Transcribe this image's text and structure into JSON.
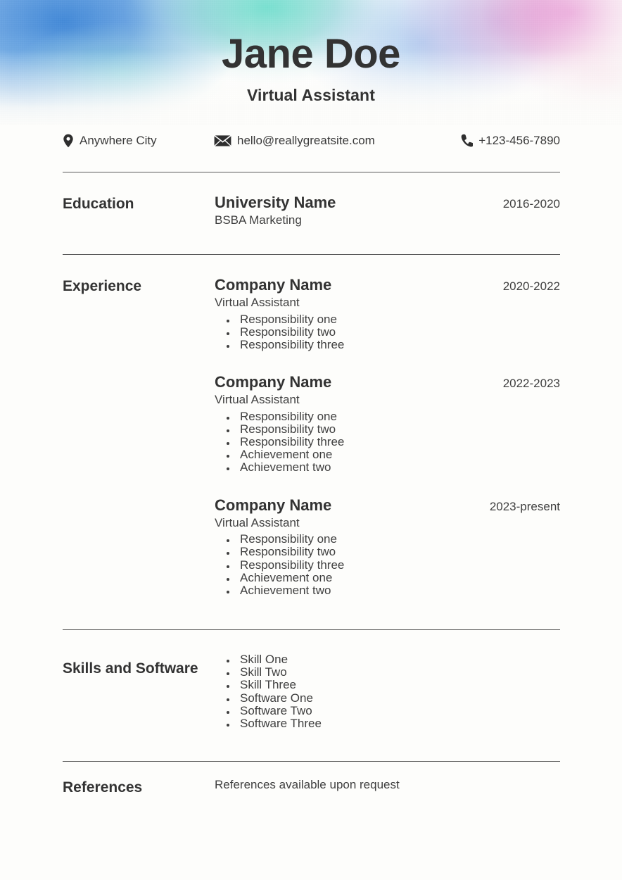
{
  "theme": {
    "page_background": "#fdfdfb",
    "text_color": "#3a3a3a",
    "heading_color": "#333333",
    "divider_color": "#5a5a5a",
    "gradient_colors": [
      "#3a84d6",
      "#6edecd",
      "#96bee b",
      "#c4ace2",
      "#e896d4",
      "#f0b2ce"
    ]
  },
  "header": {
    "name": "Jane Doe",
    "role": "Virtual Assistant"
  },
  "contact": {
    "location": {
      "icon": "location-pin-icon",
      "text": "Anywhere City"
    },
    "email": {
      "icon": "envelope-icon",
      "text": "hello@reallygreatsite.com"
    },
    "phone": {
      "icon": "phone-icon",
      "text": "+123-456-7890"
    }
  },
  "sections": {
    "education": {
      "label": "Education",
      "entries": [
        {
          "org": "University Name",
          "dates": "2016-2020",
          "subrole": "BSBA Marketing"
        }
      ]
    },
    "experience": {
      "label": "Experience",
      "entries": [
        {
          "org": "Company Name",
          "dates": "2020-2022",
          "subrole": "Virtual Assistant",
          "bullets": [
            "Responsibility one",
            "Responsibility two",
            "Responsibility three"
          ]
        },
        {
          "org": "Company Name",
          "dates": "2022-2023",
          "subrole": "Virtual Assistant",
          "bullets": [
            "Responsibility one",
            "Responsibility two",
            "Responsibility three",
            "Achievement one",
            "Achievement two"
          ]
        },
        {
          "org": "Company Name",
          "dates": "2023-present",
          "subrole": "Virtual Assistant",
          "bullets": [
            "Responsibility one",
            "Responsibility two",
            "Responsibility three",
            "Achievement one",
            "Achievement two"
          ]
        }
      ]
    },
    "skills": {
      "label": "Skills and Software",
      "bullets": [
        "Skill One",
        "Skill Two",
        "Skill Three",
        "Software One",
        "Software Two",
        "Software Three"
      ]
    },
    "references": {
      "label": "References",
      "text": "References available upon request"
    }
  }
}
